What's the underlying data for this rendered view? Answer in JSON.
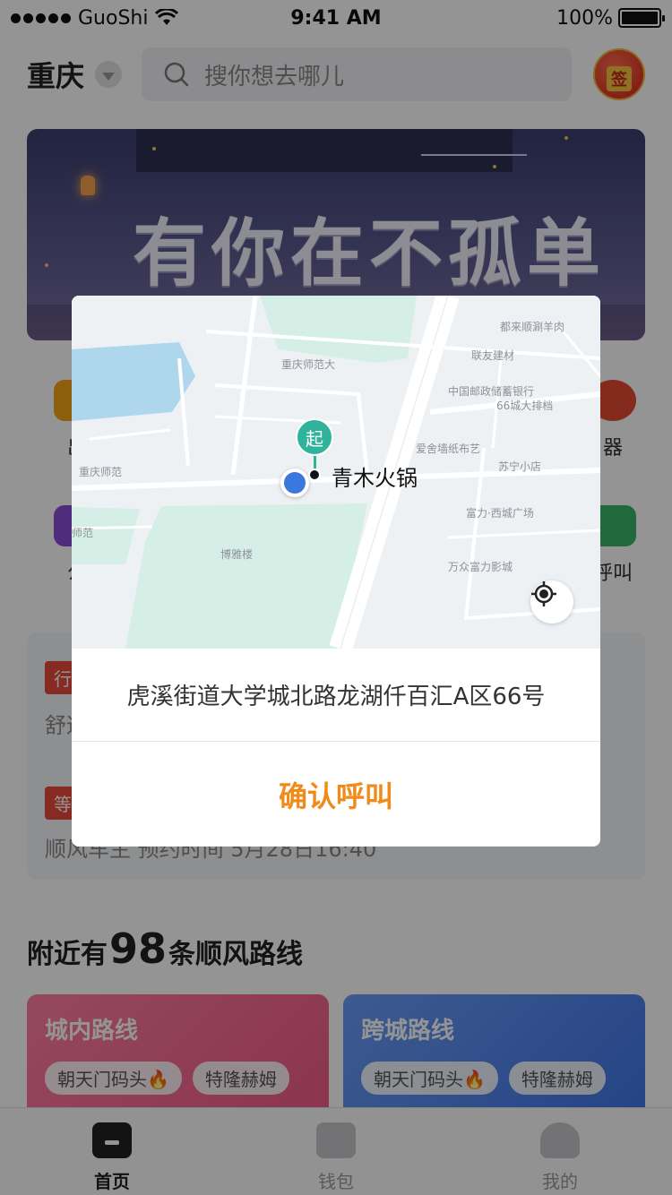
{
  "status_bar": {
    "carrier": "GuoShi",
    "time": "9:41 AM",
    "battery": "100%",
    "battery_level": 1.0
  },
  "header": {
    "city": "重庆",
    "search_placeholder": "搜你想去哪儿",
    "checkin_label": "签"
  },
  "banner": {
    "headline": "有你在不孤单"
  },
  "quick_icons": [
    {
      "label": "出",
      "color": "#f2a318"
    },
    {
      "label": "器",
      "color": "#e44a35"
    },
    {
      "label": "公",
      "color": "#8a4fd6"
    },
    {
      "label": "呼叫",
      "color": "#3cb36a"
    }
  ],
  "orders": {
    "tag1": "行",
    "line1": "舒适",
    "tag2": "等",
    "line2": "顺风车主     预约时间 5月28日16:40"
  },
  "nearby": {
    "prefix": "附近有",
    "count": "98",
    "suffix": "条顺风路线"
  },
  "routes": [
    {
      "title": "城内路线",
      "chips": [
        "朝天门码头🔥",
        "特隆赫姆"
      ]
    },
    {
      "title": "跨城路线",
      "chips": [
        "朝天门码头🔥",
        "特隆赫姆"
      ]
    }
  ],
  "tabs": [
    {
      "label": "首页",
      "active": true
    },
    {
      "label": "钱包",
      "active": false
    },
    {
      "label": "我的",
      "active": false
    }
  ],
  "dialog": {
    "pin_char": "起",
    "place_name": "青木火锅",
    "address": "虎溪街道大学城北路龙湖仟百汇A区66号",
    "confirm_label": "确认呼叫",
    "map_labels": [
      "都来顺涮羊肉",
      "联友建材",
      "重庆师范大",
      "中国邮政储蓄银行",
      "66城大排档",
      "爱舍墙纸布艺",
      "苏宁小店",
      "重庆师范",
      "富力·西城广场",
      "师范",
      "博雅楼",
      "万众富力影城"
    ]
  }
}
